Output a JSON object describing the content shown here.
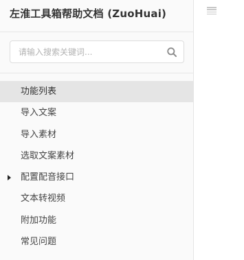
{
  "sidebar": {
    "title": "左淮工具箱帮助文档 (ZuoHuai)",
    "search": {
      "placeholder": "请输入搜索关键词...",
      "value": ""
    },
    "items": [
      {
        "label": "功能列表",
        "active": true,
        "has_children": false
      },
      {
        "label": "导入文案",
        "active": false,
        "has_children": false
      },
      {
        "label": "导入素材",
        "active": false,
        "has_children": false
      },
      {
        "label": "选取文案素材",
        "active": false,
        "has_children": false
      },
      {
        "label": "配置配音接口",
        "active": false,
        "has_children": true
      },
      {
        "label": "文本转视频",
        "active": false,
        "has_children": false
      },
      {
        "label": "附加功能",
        "active": false,
        "has_children": false
      },
      {
        "label": "常见问题",
        "active": false,
        "has_children": false
      }
    ]
  },
  "icons": {
    "search": "search-icon",
    "caret": "caret-right-icon",
    "toggle": "hamburger-menu-icon"
  },
  "colors": {
    "sidebar_bg": "#fafafa",
    "active_item_bg": "#e5e5e5",
    "text": "#444444",
    "placeholder": "#b3b3b3"
  }
}
